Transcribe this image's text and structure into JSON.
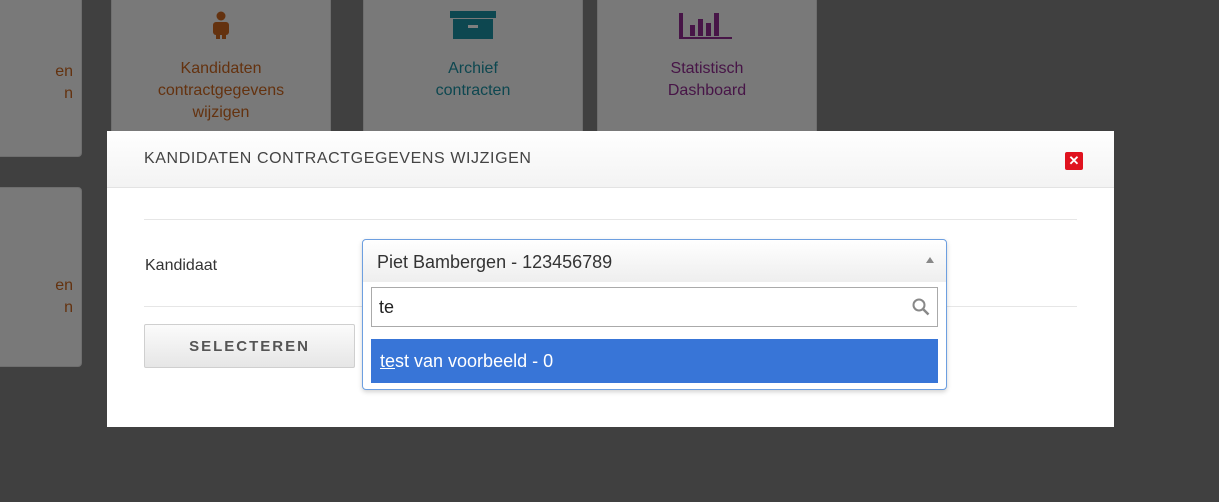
{
  "tiles": [
    {
      "label": "en\nn",
      "color": "#c8641e"
    },
    {
      "label": "Kandidaten contractgegevens wijzigen",
      "color": "#c8641e",
      "icon": "person-icon"
    },
    {
      "label": "Archief contracten",
      "color": "#1b8fa0",
      "icon": "archive-box-icon"
    },
    {
      "label": "Statistisch Dashboard",
      "color": "#8e2a8e",
      "icon": "bar-chart-icon"
    },
    {
      "label": "en\nn",
      "color": "#c8641e"
    }
  ],
  "modal": {
    "title": "KANDIDATEN CONTRACTGEGEVENS WIJZIGEN",
    "close_icon": "close-icon",
    "kandidaat_label": "Kandidaat",
    "select_button": "SELECTEREN",
    "dropdown": {
      "selected": "Piet Bambergen - 123456789",
      "search_value": "te",
      "results": [
        {
          "match": "te",
          "rest": "st van voorbeeld - 0"
        }
      ]
    }
  },
  "colors": {
    "highlight": "#3875d7",
    "close_bg": "#e0131f",
    "overlay": "#808080"
  }
}
